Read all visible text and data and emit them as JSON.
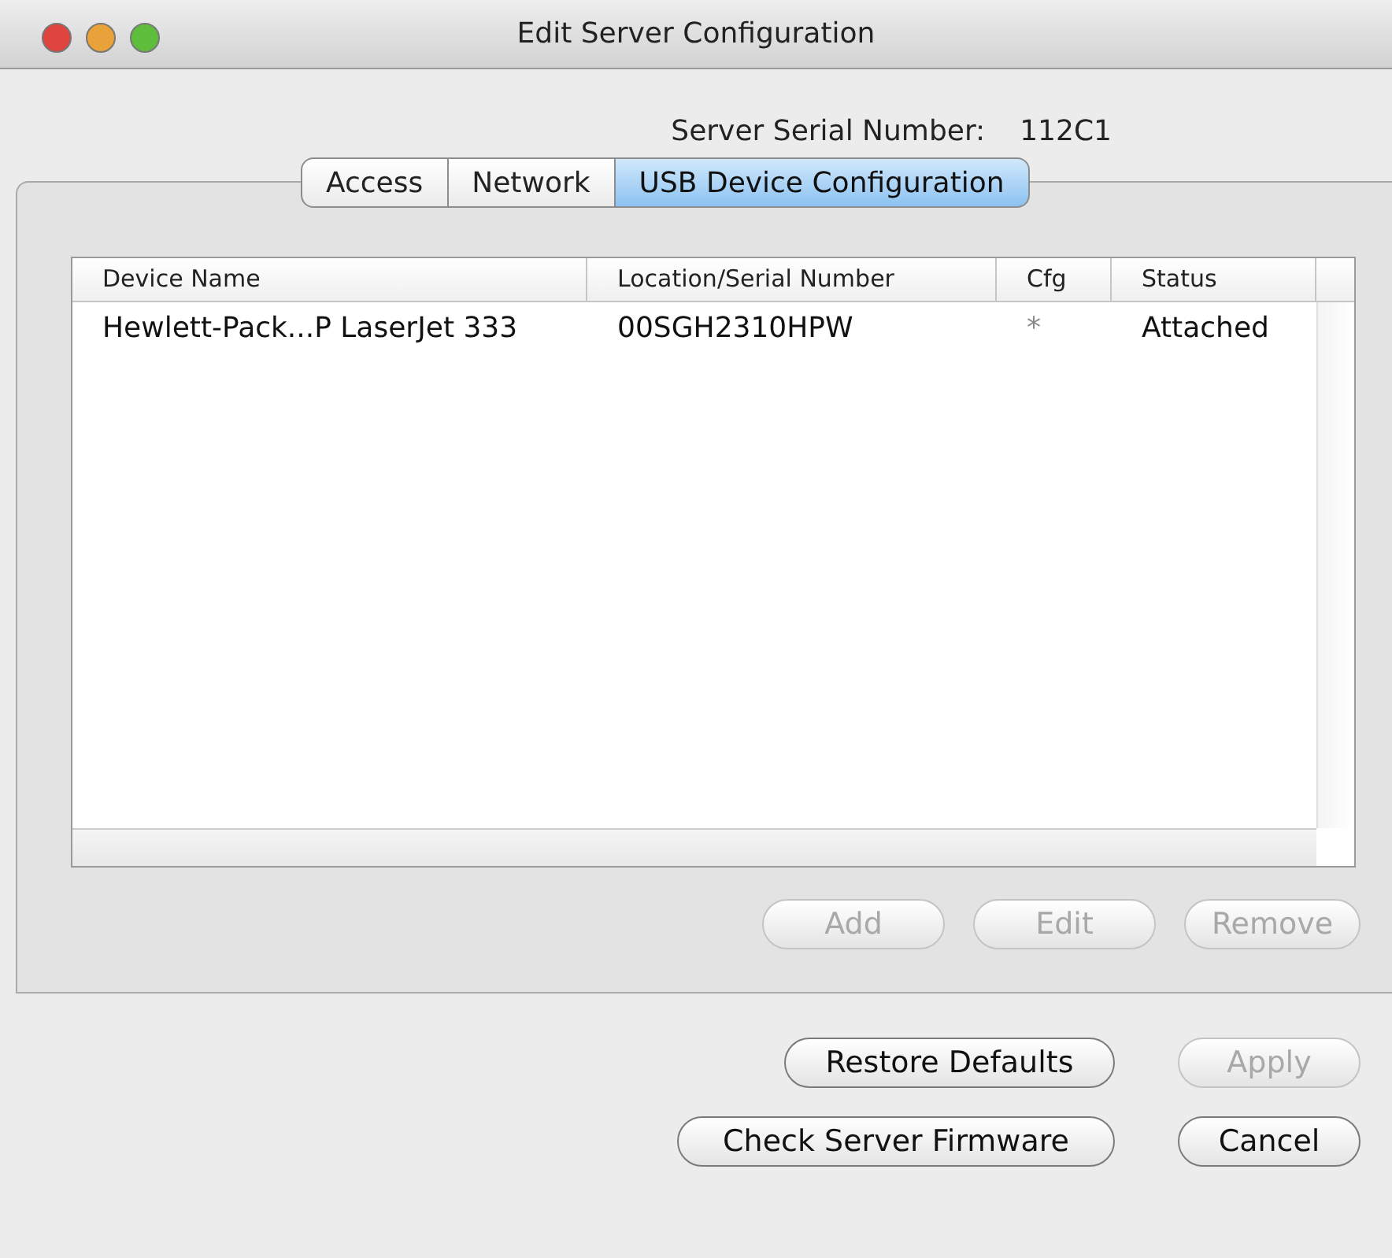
{
  "window": {
    "title": "Edit Server Configuration"
  },
  "serial": {
    "label": "Server Serial Number:",
    "value": "112C1"
  },
  "tabs": [
    {
      "label": "Access",
      "selected": false
    },
    {
      "label": "Network",
      "selected": false
    },
    {
      "label": "USB Device Configuration",
      "selected": true
    }
  ],
  "table": {
    "columns": [
      "Device Name",
      "Location/Serial Number",
      "Cfg",
      "Status"
    ],
    "rows": [
      [
        "Hewlett-Pack...P LaserJet 333",
        "00SGH2310HPW",
        "*",
        "Attached"
      ]
    ]
  },
  "table_buttons": [
    {
      "label": "Add",
      "disabled": true
    },
    {
      "label": "Edit",
      "disabled": true
    },
    {
      "label": "Remove",
      "disabled": true
    }
  ],
  "bottom_buttons": [
    [
      {
        "label": "Restore Defaults",
        "disabled": false
      },
      {
        "label": "Apply",
        "disabled": true
      }
    ],
    [
      {
        "label": "Check Server Firmware",
        "disabled": false
      },
      {
        "label": "Cancel",
        "disabled": false
      }
    ]
  ]
}
